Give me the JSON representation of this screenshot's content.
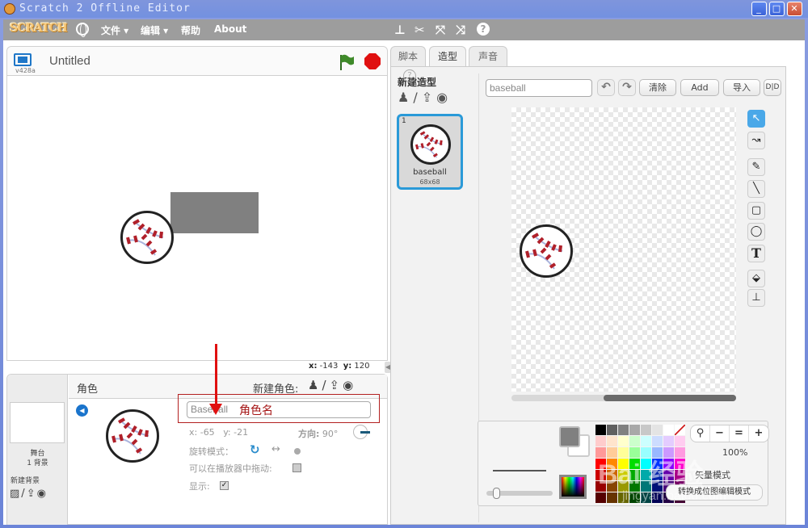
{
  "window": {
    "title": "Scratch 2 Offline Editor",
    "minimize_label": "_",
    "maximize_label": "□",
    "close_label": "✕"
  },
  "menubar": {
    "logo": "SCRATCH",
    "items": [
      {
        "label": "文件 ▾"
      },
      {
        "label": "编辑 ▾"
      },
      {
        "label": "帮助"
      },
      {
        "label": "About"
      }
    ],
    "tools": [
      {
        "icon": "stamp-icon",
        "glyph": "⊥"
      },
      {
        "icon": "scissors-icon",
        "glyph": "✂"
      },
      {
        "icon": "grow-icon",
        "glyph": "⤧"
      },
      {
        "icon": "shrink-icon",
        "glyph": "⤨"
      },
      {
        "icon": "help-icon",
        "glyph": "?"
      }
    ]
  },
  "stage": {
    "version": "v428a",
    "project_title": "Untitled",
    "mouse_x_label": "x:",
    "mouse_x": "-143",
    "mouse_y_label": "y:",
    "mouse_y": "120"
  },
  "sprite_panel": {
    "title": "角色",
    "new_sprite_label": "新建角色:",
    "new_sprite_icons": [
      "♟",
      "/",
      "⇪",
      "◉"
    ],
    "stage_label": "舞台",
    "backdrop_count": "1 背景",
    "new_backdrop_label": "新建背景",
    "new_backdrop_icons": [
      "▨",
      "/",
      "⇪",
      "◉"
    ],
    "sprite_name": "Baseball",
    "annotation": "角色名",
    "x_label": "x:",
    "x": "-65",
    "y_label": "y:",
    "y": "-21",
    "direction_label": "方向:",
    "direction": "90°",
    "rotation_label": "旋转模式：",
    "rotation_all_around": "↻",
    "rotation_left_right": "↔",
    "draggable_label": "可以在播放器中拖动:",
    "draggable": false,
    "show_label": "显示:",
    "show": true,
    "show_check": "✓"
  },
  "tabs": [
    {
      "label": "脚本",
      "active": false
    },
    {
      "label": "造型",
      "active": true
    },
    {
      "label": "声音",
      "active": false
    }
  ],
  "costumes": {
    "new_costume_label": "新建造型",
    "new_costume_icons": [
      "♟",
      "/",
      "⇪",
      "◉"
    ],
    "list": [
      {
        "number": "1",
        "name": "baseball",
        "size": "68x68",
        "selected": true
      }
    ]
  },
  "paint_editor": {
    "costume_name": "baseball",
    "undo": "↶",
    "redo": "↷",
    "clear_label": "清除",
    "add_label": "Add",
    "import_label": "导入",
    "flip_label": "D|D",
    "help": "?",
    "tools": [
      {
        "name": "select-tool",
        "glyph": "↖",
        "active": true
      },
      {
        "name": "reshape-tool",
        "glyph": "↝",
        "active": false
      },
      {
        "name": "pencil-tool",
        "glyph": "✎",
        "active": false
      },
      {
        "name": "line-tool",
        "glyph": "╲",
        "active": false
      },
      {
        "name": "rectangle-tool",
        "glyph": "▢",
        "active": false
      },
      {
        "name": "ellipse-tool",
        "glyph": "◯",
        "active": false
      },
      {
        "name": "text-tool",
        "glyph": "T",
        "active": false
      },
      {
        "name": "fill-tool",
        "glyph": "⬙",
        "active": false
      },
      {
        "name": "stamp-tool",
        "glyph": "⊥",
        "active": false
      }
    ],
    "horizontal_scroll_position": 0.41,
    "line_width": 0.1,
    "primary_color": "#808080",
    "secondary_color": "#ffffff",
    "palette": [
      "#000000",
      "#606060",
      "#808080",
      "#a8a8a8",
      "#c8c8c8",
      "#e4e4e4",
      "#ffffff",
      "none",
      "#ffcccc",
      "#ffe4cc",
      "#ffffcc",
      "#ccffcc",
      "#ccffff",
      "#ccdcff",
      "#e4ccff",
      "#ffccf0",
      "#ff9999",
      "#ffcc99",
      "#ffff99",
      "#99ff99",
      "#99ffff",
      "#99b8ff",
      "#cc99ff",
      "#ff99e0",
      "#ff0000",
      "#ff8800",
      "#ffff00",
      "#00dd00",
      "#00ffff",
      "#0033ff",
      "#8800ff",
      "#ff00cc",
      "#cc0000",
      "#cc6600",
      "#cccc00",
      "#00aa00",
      "#00aaaa",
      "#0022aa",
      "#6600aa",
      "#aa0088",
      "#990000",
      "#884400",
      "#999900",
      "#007700",
      "#007777",
      "#001177",
      "#440077",
      "#770066",
      "#550000",
      "#663300",
      "#666600",
      "#004400",
      "#004444",
      "#000055",
      "#220044",
      "#440033"
    ],
    "zoom_out": "−",
    "zoom_reset": "=",
    "zoom_in": "+",
    "eyedropper": "⚲",
    "zoom_level": "100%",
    "mode_label": "矢量模式",
    "convert_label": "转换成位图编辑模式"
  },
  "watermark": {
    "text": "Bai 经验",
    "sub": "jingyan.baidu.com"
  }
}
